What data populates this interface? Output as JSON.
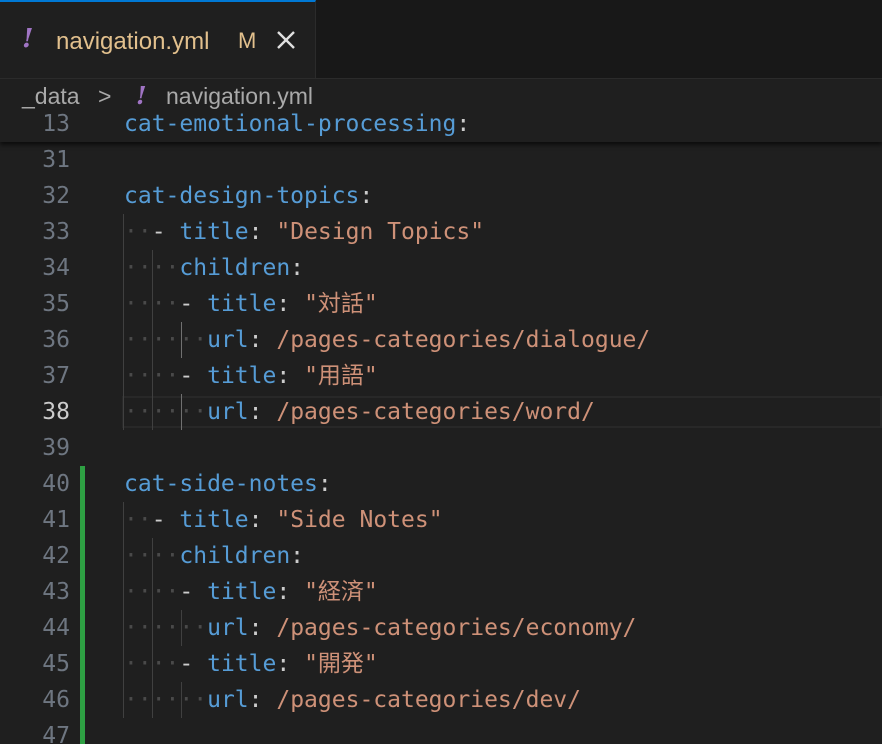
{
  "tab": {
    "icon": "yaml-exclamation-icon",
    "icon_glyph": "!",
    "label": "navigation.yml",
    "modified_badge": "M",
    "close_icon": "close-icon"
  },
  "breadcrumb": {
    "folder": "_data",
    "separator": ">",
    "icon_glyph": "!",
    "file": "navigation.yml"
  },
  "sticky": {
    "line_number": "13",
    "key": "cat-emotional-processing",
    "colon": ":"
  },
  "lines": [
    {
      "n": "31"
    },
    {
      "n": "32",
      "key": "cat-design-topics",
      "colon": ":"
    },
    {
      "n": "33",
      "ws": "··",
      "dash": "-",
      "key": "title",
      "colon": ":",
      "value": "\"Design Topics\""
    },
    {
      "n": "34",
      "ws": "····",
      "key": "children",
      "colon": ":"
    },
    {
      "n": "35",
      "ws": "····",
      "dash": "-",
      "key": "title",
      "colon": ":",
      "value": "\"対話\""
    },
    {
      "n": "36",
      "ws": "······",
      "key": "url",
      "colon": ":",
      "value": "/pages-categories/dialogue/"
    },
    {
      "n": "37",
      "ws": "····",
      "dash": "-",
      "key": "title",
      "colon": ":",
      "value": "\"用語\""
    },
    {
      "n": "38",
      "ws": "······",
      "key": "url",
      "colon": ":",
      "value": "/pages-categories/word/"
    },
    {
      "n": "39"
    },
    {
      "n": "40",
      "key": "cat-side-notes",
      "colon": ":"
    },
    {
      "n": "41",
      "ws": "··",
      "dash": "-",
      "key": "title",
      "colon": ":",
      "value": "\"Side Notes\""
    },
    {
      "n": "42",
      "ws": "····",
      "key": "children",
      "colon": ":"
    },
    {
      "n": "43",
      "ws": "····",
      "dash": "-",
      "key": "title",
      "colon": ":",
      "value": "\"経済\""
    },
    {
      "n": "44",
      "ws": "······",
      "key": "url",
      "colon": ":",
      "value": "/pages-categories/economy/"
    },
    {
      "n": "45",
      "ws": "····",
      "dash": "-",
      "key": "title",
      "colon": ":",
      "value": "\"開発\""
    },
    {
      "n": "46",
      "ws": "······",
      "key": "url",
      "colon": ":",
      "value": "/pages-categories/dev/"
    },
    {
      "n": "47"
    }
  ],
  "active_line": "38",
  "colors": {
    "key": "#569cd6",
    "string": "#ce9178",
    "modified": "#e2c08d",
    "yaml_icon": "#a074c4",
    "git_added": "#2ea043",
    "tab_accent": "#0078d4"
  }
}
